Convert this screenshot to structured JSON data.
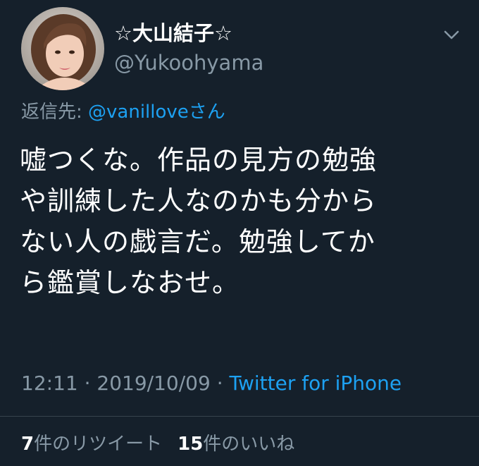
{
  "author": {
    "display_name": "☆大山結子☆",
    "handle": "@Yukoohyama"
  },
  "icons": {
    "avatar": "profile-photo",
    "caret": "chevron-down-icon"
  },
  "reply": {
    "prefix": "返信先: ",
    "target": "@vanilloveさん"
  },
  "tweet": {
    "lines": [
      "嘘つくな。作品の見方の勉強",
      "や訓練した人なのかも分から",
      "ない人の戯言だ。勉強してか",
      "ら鑑賞しなおせ。"
    ]
  },
  "meta": {
    "time": "12:11",
    "separator": " · ",
    "date": "2019/10/09",
    "source": "Twitter for iPhone"
  },
  "stats": {
    "retweet_count": "7",
    "retweet_label": "件のリツイート",
    "like_count": "15",
    "like_label": "件のいいね"
  },
  "colors": {
    "background": "#15202b",
    "text": "#ffffff",
    "secondary": "#8899a6",
    "link": "#1da1f2",
    "divider": "#38444d"
  }
}
